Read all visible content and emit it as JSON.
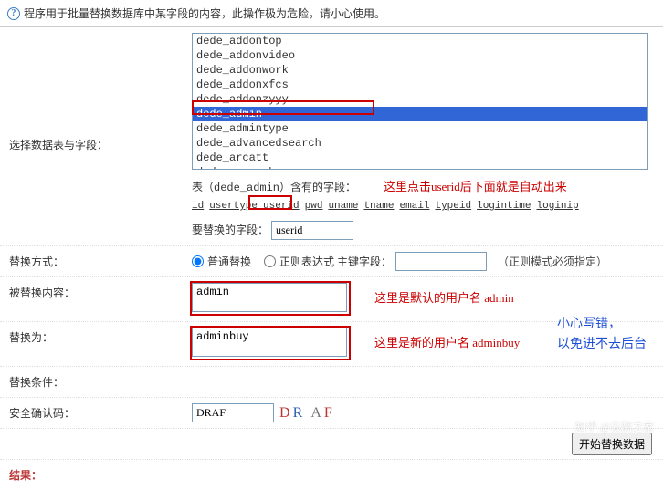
{
  "warning": "程序用于批量替换数据库中某字段的内容，此操作极为危险，请小心使用。",
  "labels": {
    "select_table": "选择数据表与字段：",
    "replace_mode": "替换方式：",
    "replaced_content": "被替换内容：",
    "replace_to": "替换为：",
    "condition": "替换条件：",
    "captcha": "安全确认码：",
    "result": "结果："
  },
  "listbox": {
    "items": [
      "dede_addontop",
      "dede_addonvideo",
      "dede_addonwork",
      "dede_addonxfcs",
      "dede_addonzyyy",
      "dede_admin",
      "dede_admintype",
      "dede_advancedsearch",
      "dede_arcatt",
      "dede_arccache"
    ],
    "selected_index": 5
  },
  "fields_header_prefix": "表（dede_admin）含有的字段：",
  "fields": [
    "id",
    "usertype",
    "userid",
    "pwd",
    "uname",
    "tname",
    "email",
    "typeid",
    "logintime",
    "loginip"
  ],
  "replace_field_label": "要替换的字段：",
  "replace_field_value": "userid",
  "mode": {
    "normal": "普通替换",
    "regex": "正则表达式 主键字段：",
    "regex_input": "",
    "note": "（正则模式必须指定）"
  },
  "content_from": "admin",
  "content_to": "adminbuy",
  "captcha_value": "DRAF",
  "captcha_display": [
    "D",
    "R",
    "A",
    "F"
  ],
  "submit": "开始替换数据",
  "annotations": {
    "a1": "这里点击userid后下面就是自动出来",
    "a2": "这里是默认的用户名 admin",
    "a3": "这里是新的用户名 adminbuy",
    "a4": "小心写错，\n以免进不去后台"
  },
  "watermark": "知乎 @云鹄之家"
}
